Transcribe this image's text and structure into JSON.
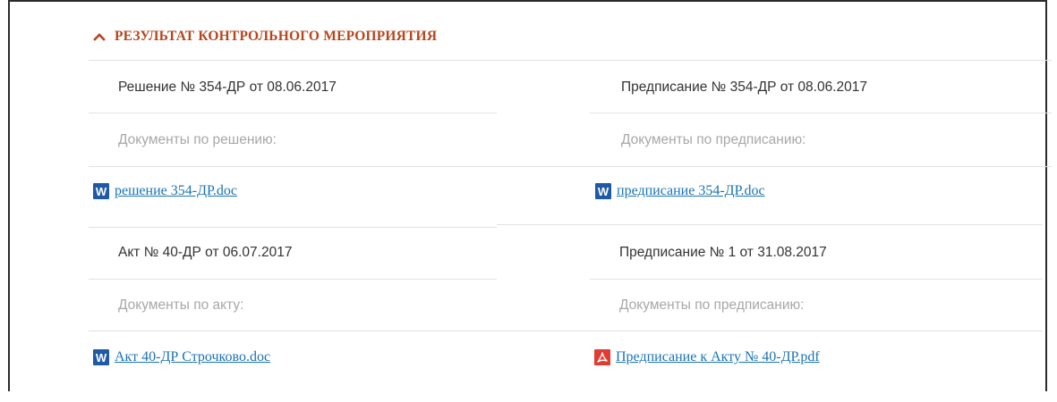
{
  "section": {
    "title": "РЕЗУЛЬТАТ КОНТРОЛЬНОГО МЕРОПРИЯТИЯ",
    "expanded": true,
    "accent_color": "#b8451c"
  },
  "blocks": [
    {
      "title": "Решение № 354-ДР от 08.06.2017",
      "docs_label": "Документы по решению:",
      "file": {
        "name": "решение 354-ДР.doc",
        "type": "word",
        "icon": "word-icon"
      }
    },
    {
      "title": "Предписание № 354-ДР от 08.06.2017",
      "docs_label": "Документы по предписанию:",
      "file": {
        "name": "предписание 354-ДР.doc",
        "type": "word",
        "icon": "word-icon"
      }
    },
    {
      "title": "Акт № 40-ДР от 06.07.2017",
      "docs_label": "Документы по акту:",
      "file": {
        "name": "Акт 40-ДР Строчково.doc",
        "type": "word",
        "icon": "word-icon"
      }
    },
    {
      "title": "Предписание № 1 от 31.08.2017",
      "docs_label": "Документы по предписанию:",
      "file": {
        "name": "Предписание к Акту № 40-ДР.pdf",
        "type": "pdf",
        "icon": "pdf-icon"
      }
    }
  ],
  "icons": {
    "word_letter": "W",
    "link_color": "#1a73b5",
    "word_color": "#1f5aa8",
    "pdf_color": "#e03c31"
  }
}
